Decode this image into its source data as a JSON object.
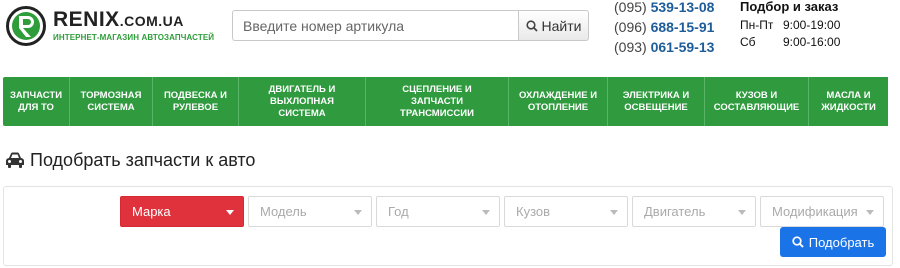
{
  "header": {
    "logo": {
      "name": "RENIX",
      "domain": ".COM.UA",
      "tagline": "ИНТЕРНЕТ-МАГАЗИН АВТОЗАПЧАСТЕЙ",
      "brand_color": "#2e9d3a"
    },
    "search": {
      "placeholder": "Введите номер артикула",
      "button_label": "Найти",
      "icon": "search-icon"
    },
    "phones": [
      {
        "code": "(095)",
        "number": "539-13-08"
      },
      {
        "code": "(096)",
        "number": "688-15-91"
      },
      {
        "code": "(093)",
        "number": "061-59-13"
      }
    ],
    "hours": {
      "title": "Подбор и заказ",
      "rows": [
        {
          "days": "Пн-Пт",
          "time": "9:00-19:00"
        },
        {
          "days": "Сб",
          "time": "9:00-16:00"
        }
      ]
    }
  },
  "nav": {
    "color": "#2f9a3e",
    "items": [
      {
        "line1": "ЗАПЧАСТИ",
        "line2": "ДЛЯ ТО",
        "line3": ""
      },
      {
        "line1": "ТОРМОЗНАЯ",
        "line2": "СИСТЕМА",
        "line3": ""
      },
      {
        "line1": "ПОДВЕСКА И",
        "line2": "РУЛЕВОЕ",
        "line3": ""
      },
      {
        "line1": "ДВИГАТЕЛЬ И",
        "line2": "ВЫХЛОПНАЯ",
        "line3": "СИСТЕМА"
      },
      {
        "line1": "СЦЕПЛЕНИЕ И",
        "line2": "ЗАПЧАСТИ",
        "line3": "ТРАНСМИССИИ"
      },
      {
        "line1": "ОХЛАЖДЕНИЕ И",
        "line2": "ОТОПЛЕНИЕ",
        "line3": ""
      },
      {
        "line1": "ЭЛЕКТРИКА И",
        "line2": "ОСВЕЩЕНИЕ",
        "line3": ""
      },
      {
        "line1": "КУЗОВ И",
        "line2": "СОСТАВЛЯЮЩИЕ",
        "line3": ""
      },
      {
        "line1": "МАСЛА И",
        "line2": "ЖИДКОСТИ",
        "line3": ""
      }
    ]
  },
  "selector": {
    "title": "Подобрать запчасти к авто",
    "title_icon": "car-icon",
    "selects": [
      {
        "label": "Марка",
        "active": true
      },
      {
        "label": "Модель",
        "active": false
      },
      {
        "label": "Год",
        "active": false
      },
      {
        "label": "Кузов",
        "active": false
      },
      {
        "label": "Двигатель",
        "active": false
      },
      {
        "label": "Модификация",
        "active": false
      }
    ],
    "active_color": "#e0323c",
    "button_label": "Подобрать",
    "button_color": "#1b73e8"
  }
}
